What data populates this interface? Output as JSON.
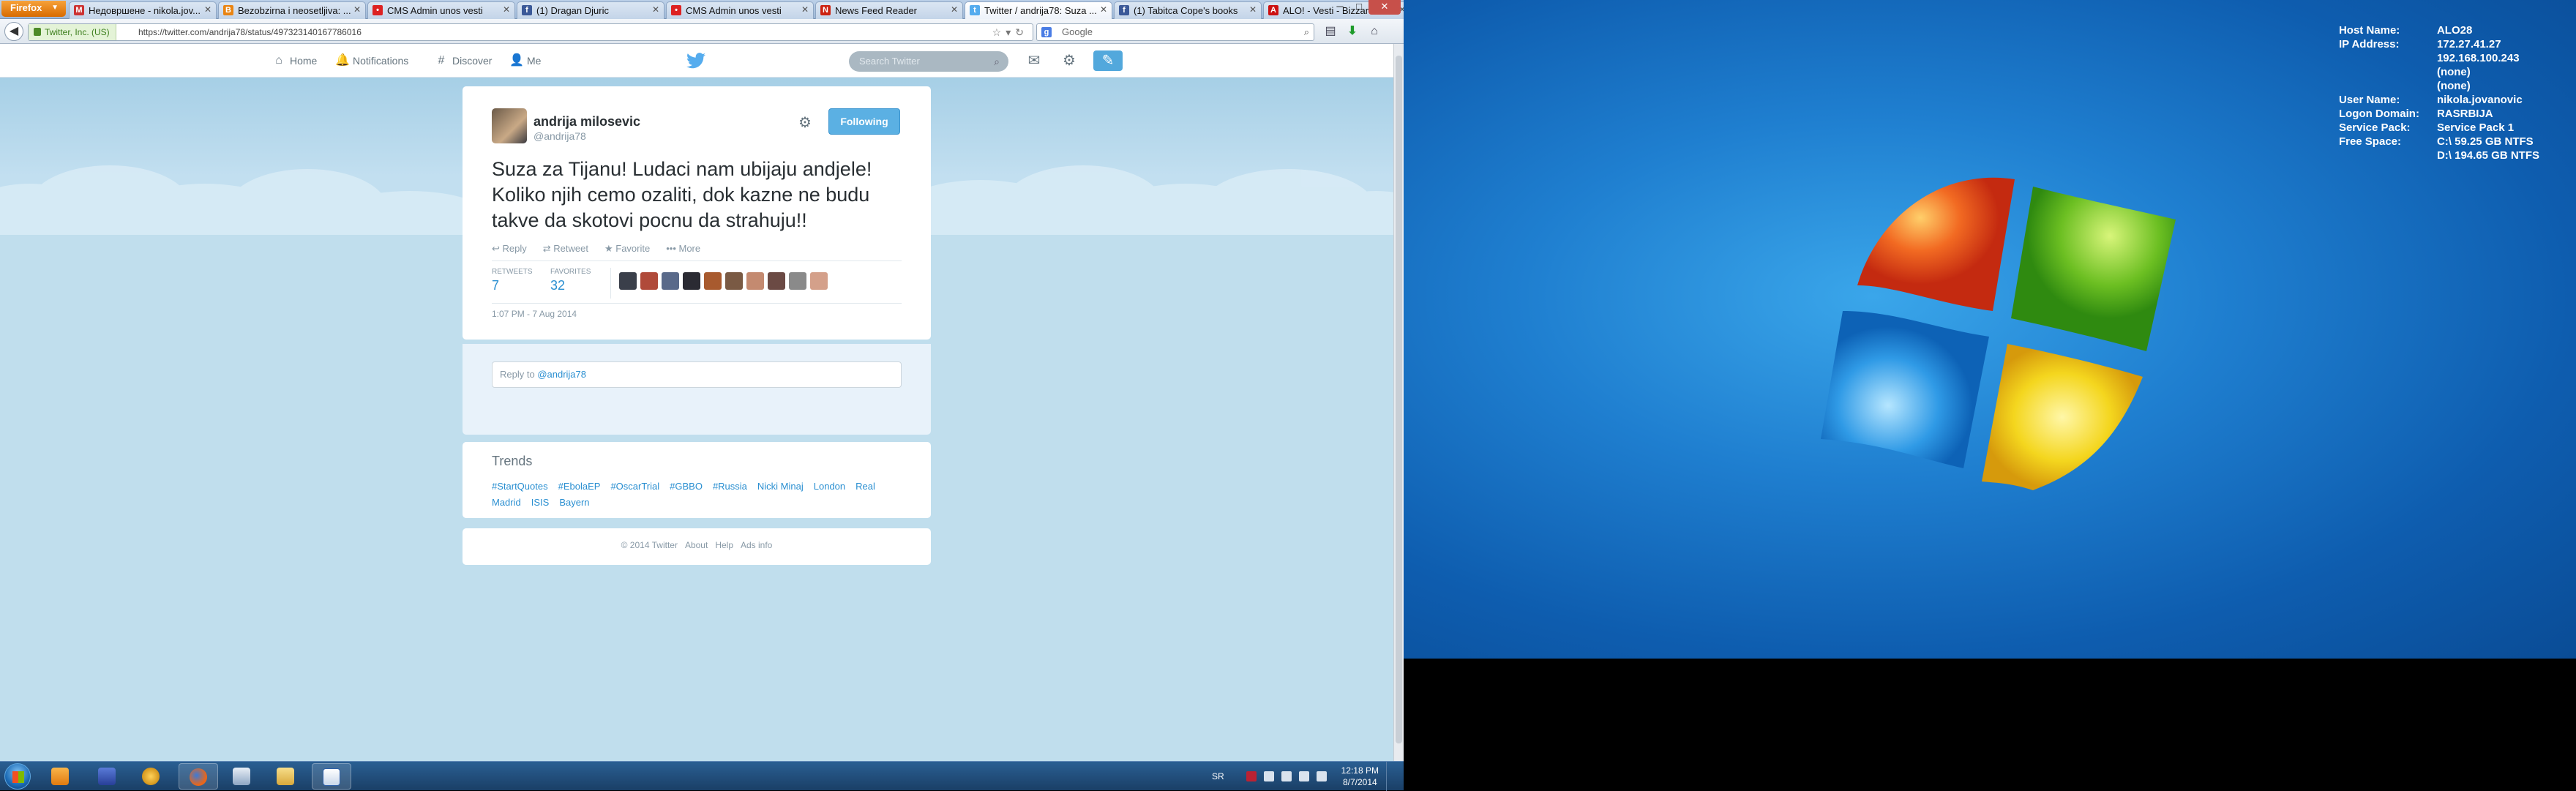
{
  "browser": {
    "app_button": "Firefox",
    "tabs": [
      {
        "label": "Недовршене - nikola.jov...",
        "fav_color": "#c33",
        "fav": "M",
        "active": false
      },
      {
        "label": "Bezobzirna i neosetljiva: ...",
        "fav_color": "#e98412",
        "fav": "B",
        "active": false
      },
      {
        "label": "CMS Admin unos vesti",
        "fav_color": "#d22",
        "fav": "•",
        "active": false
      },
      {
        "label": "(1) Dragan Djuric",
        "fav_color": "#3b5998",
        "fav": "f",
        "active": false
      },
      {
        "label": "CMS Admin unos vesti",
        "fav_color": "#d22",
        "fav": "•",
        "active": false
      },
      {
        "label": "News Feed Reader",
        "fav_color": "#c21",
        "fav": "N",
        "active": false
      },
      {
        "label": "Twitter / andrija78: Suza ...",
        "fav_color": "#55acee",
        "fav": "t",
        "active": true
      },
      {
        "label": "(1) Tabitca Cope's books",
        "fav_color": "#3b5998",
        "fav": "f",
        "active": false
      },
      {
        "label": "ALO! - Vesti - Bizzare",
        "fav_color": "#c11",
        "fav": "A",
        "active": false
      }
    ],
    "site_identity": "Twitter, Inc. (US)",
    "url": "https://twitter.com/andrija78/status/497323140167786016",
    "search_placeholder": "Google"
  },
  "twitter": {
    "nav": {
      "home": "Home",
      "notifications": "Notifications",
      "discover": "Discover",
      "me": "Me"
    },
    "search_placeholder": "Search Twitter",
    "tweet": {
      "author_name": "andrija milosevic",
      "author_handle": "@andrija78",
      "follow_label": "Following",
      "text": "Suza za Tijanu! Ludaci nam ubijaju andjele! Koliko njih cemo ozaliti, dok kazne ne budu takve da skotovi pocnu da strahuju!!",
      "actions": {
        "reply": "Reply",
        "retweet": "Retweet",
        "favorite": "Favorite",
        "more": "More"
      },
      "retweets_label": "RETWEETS",
      "retweets": "7",
      "favorites_label": "FAVORITES",
      "favorites": "32",
      "timestamp": "1:07 PM - 7 Aug 2014",
      "favoriter_avatar_colors": [
        "#3a3f4a",
        "#b04a3a",
        "#5a6a8a",
        "#2b2b33",
        "#a85a2e",
        "#7a5a44",
        "#c48a70",
        "#6b4a44",
        "#8a8a8a",
        "#d4a08a"
      ]
    },
    "reply": {
      "prefix": "Reply to ",
      "handle": "@andrija78"
    },
    "trends": {
      "title": "Trends",
      "items": [
        "#StartQuotes",
        "#EbolaEP",
        "#OscarTrial",
        "#GBBO",
        "#Russia",
        "Nicki Minaj",
        "London",
        "Real Madrid",
        "ISIS",
        "Bayern"
      ]
    },
    "footer": [
      "© 2014 Twitter",
      "About",
      "Help",
      "Ads info"
    ]
  },
  "taskbar": {
    "language": "SR",
    "time": "12:18 PM",
    "date": "8/7/2014"
  },
  "desktop_info": [
    {
      "key": "Host Name:",
      "value": "ALO28"
    },
    {
      "key": "IP Address:",
      "value": "172.27.41.27"
    },
    {
      "key": "",
      "value": "192.168.100.243"
    },
    {
      "key": "",
      "value": "(none)"
    },
    {
      "key": "",
      "value": "(none)"
    },
    {
      "key": "User Name:",
      "value": "nikola.jovanovic"
    },
    {
      "key": "Logon Domain:",
      "value": "RASRBIJA"
    },
    {
      "key": "Service Pack:",
      "value": "Service Pack 1"
    },
    {
      "key": "Free Space:",
      "value": "C:\\ 59.25 GB NTFS"
    },
    {
      "key": "",
      "value": "D:\\ 194.65 GB NTFS"
    }
  ]
}
